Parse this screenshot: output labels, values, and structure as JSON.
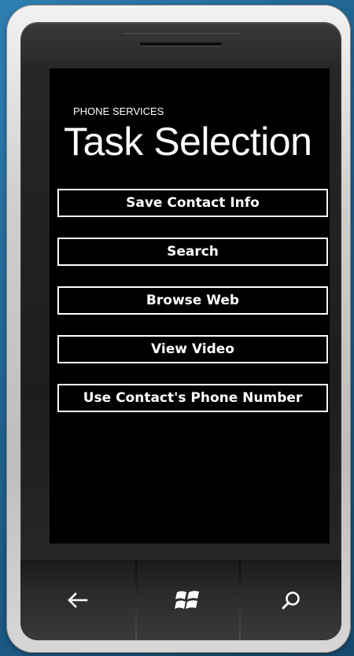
{
  "app": {
    "title": "PHONE SERVICES",
    "page_title": "Task Selection"
  },
  "tasks": [
    {
      "label": "Save Contact Info"
    },
    {
      "label": "Search"
    },
    {
      "label": "Browse Web"
    },
    {
      "label": "View Video"
    },
    {
      "label": "Use Contact's Phone Number"
    }
  ],
  "hardware_keys": {
    "back": "back-arrow-icon",
    "start": "windows-logo-icon",
    "search": "search-icon"
  },
  "colors": {
    "screen_background": "#000000",
    "foreground": "#ffffff"
  }
}
